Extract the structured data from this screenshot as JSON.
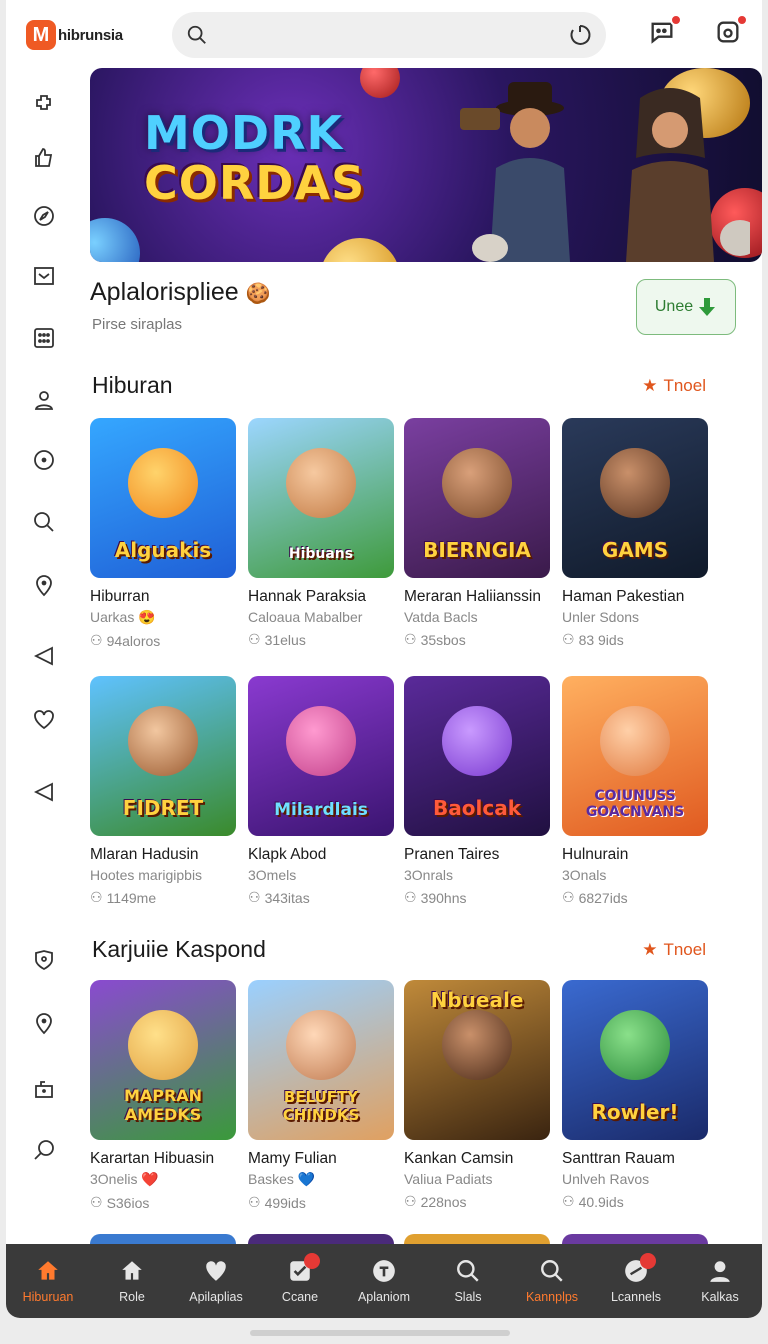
{
  "header": {
    "logo_mark": "M",
    "logo_text": "hibrunsia",
    "search_placeholder": ""
  },
  "banner": {
    "title_line1": "MODRK",
    "title_line2": "CORDAS"
  },
  "intro": {
    "title": "Aplalorispliee",
    "emoji": "🍪",
    "subtitle": "Pirse siraplas",
    "button_label": "Unee"
  },
  "sections": [
    {
      "title": "Hiburan",
      "more_label": "Tnoel",
      "cards": [
        {
          "name": "Hiburran",
          "sub": "Uarkas 😍",
          "count": "94aloros",
          "thumb_text": "Alguakis"
        },
        {
          "name": "Hannak Paraksia",
          "sub": "Caloaua Mabalber",
          "count": "31elus",
          "thumb_text": "Hibuans"
        },
        {
          "name": "Meraran Haliianssin",
          "sub": "Vatda Bacls",
          "count": "35sbos",
          "thumb_text": "BIERNGIA"
        },
        {
          "name": "Haman Pakestian",
          "sub": "Unler Sdons",
          "count": "83 9ids",
          "thumb_text": "GAMS"
        }
      ]
    },
    {
      "title": "",
      "more_label": "",
      "cards": [
        {
          "name": "Mlaran Hadusin",
          "sub": "Hootes marigipbis",
          "count": "1149me",
          "thumb_text": "FIDRET"
        },
        {
          "name": "Klapk Abod",
          "sub": "3Omels",
          "count": "343itas",
          "thumb_text": "Milardlais"
        },
        {
          "name": "Pranen Taires",
          "sub": "3Onrals",
          "count": "390hns",
          "thumb_text": "Baolcak"
        },
        {
          "name": "Hulnurain",
          "sub": "3Onals",
          "count": "6827ids",
          "thumb_text": "COIUNUSS GOACNVANS"
        }
      ]
    },
    {
      "title": "Karjuiie Kaspond",
      "more_label": "Tnoel",
      "cards": [
        {
          "name": "Karartan Hibuasin",
          "sub": "3Onelis ❤️",
          "count": "S36ios",
          "thumb_text": "MAPRAN AMEDKS"
        },
        {
          "name": "Mamy Fulian",
          "sub": "Baskes 💙",
          "count": "499ids",
          "thumb_text": "BELUFTY CHINDKS"
        },
        {
          "name": "Kankan Camsin",
          "sub": "Valiua Padiats",
          "count": "228nos",
          "thumb_text": "Nbueale"
        },
        {
          "name": "Santtran Rauam",
          "sub": "Unlveh Ravos",
          "count": "40.9ids",
          "thumb_text": "Rowler!"
        }
      ]
    }
  ],
  "bottom_nav": [
    {
      "label": "Hiburuan",
      "icon": "home-icon",
      "active": true
    },
    {
      "label": "Role",
      "icon": "house-icon"
    },
    {
      "label": "Apilaplias",
      "icon": "heart-icon"
    },
    {
      "label": "Ccane",
      "icon": "check-box-icon",
      "badge": true
    },
    {
      "label": "Aplaniom",
      "icon": "circle-t-icon"
    },
    {
      "label": "Slals",
      "icon": "search-icon"
    },
    {
      "label": "Kannplps",
      "icon": "search-icon",
      "active": true
    },
    {
      "label": "Lcannels",
      "icon": "chat-icon",
      "badge": true
    },
    {
      "label": "Kalkas",
      "icon": "person-icon"
    }
  ],
  "colors": {
    "accent": "#ef5a24",
    "nav_bg": "#3a3a3a",
    "active": "#ff7a2e",
    "badge": "#e53935"
  }
}
